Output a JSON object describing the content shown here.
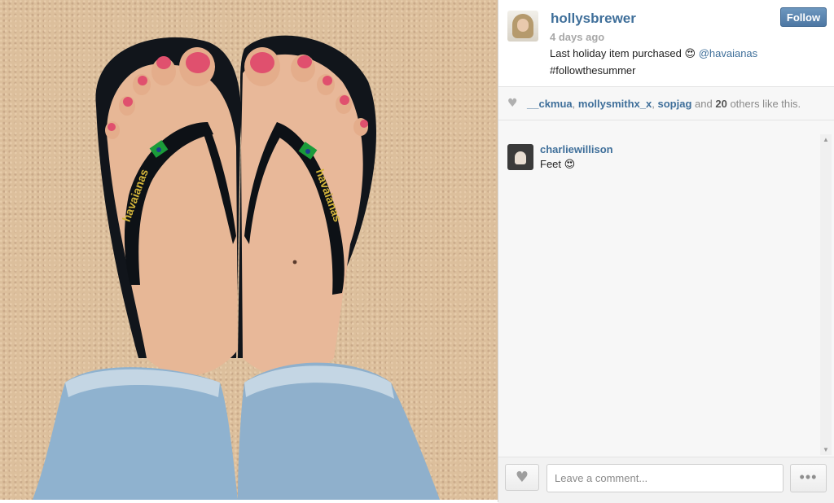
{
  "post": {
    "username": "hollysbrewer",
    "time_ago": "4 days ago",
    "caption_text": "Last holiday item purchased",
    "caption_emoji": "😍",
    "caption_mention": "@havaianas",
    "caption_hashtag": "#followthesummer",
    "follow_label": "Follow",
    "photo_brand_text": "havaianas"
  },
  "likes": {
    "users": [
      "__ckmua",
      "mollysmithx_x",
      "sopjag"
    ],
    "sep_comma": ",",
    "and_text": "and",
    "count": "20",
    "suffix": "others like this."
  },
  "comments": [
    {
      "user": "charliewillison",
      "text": "Feet",
      "emoji": "😍"
    }
  ],
  "footer": {
    "comment_placeholder": "Leave a comment...",
    "more_label": "•••"
  },
  "icons": {
    "heart": "heart-icon",
    "more": "more-options-icon",
    "scroll_up": "scroll-up-icon",
    "scroll_down": "scroll-down-icon"
  },
  "colors": {
    "link_blue": "#3f6f9a",
    "follow_button": "#5a84ae",
    "panel_bg": "#f7f7f7",
    "muted_text": "#a8a8a8"
  }
}
